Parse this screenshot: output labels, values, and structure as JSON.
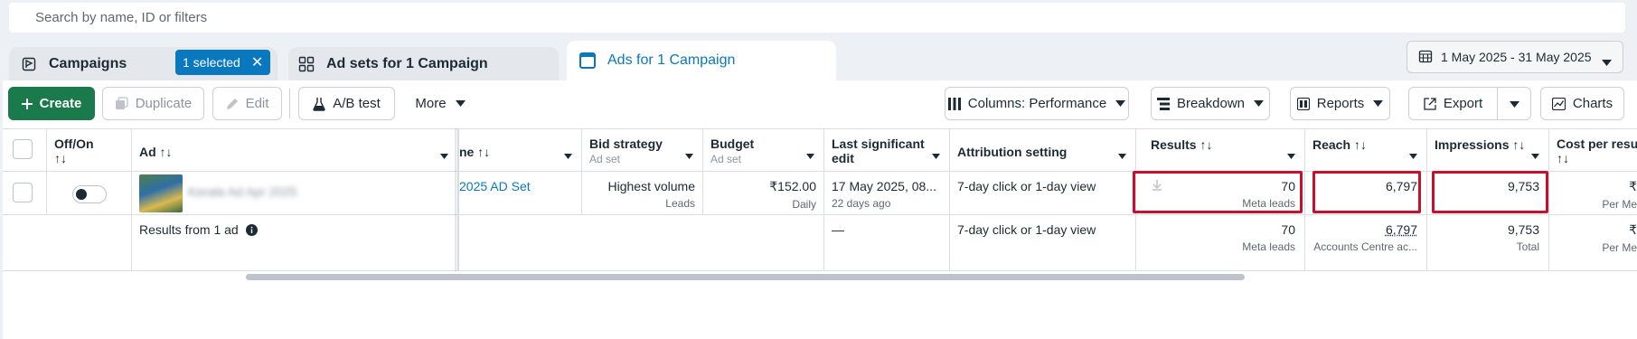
{
  "search": {
    "placeholder": "Search by name, ID or filters"
  },
  "tabs": {
    "campaigns": {
      "label": "Campaigns",
      "selected_badge": "1 selected"
    },
    "adsets": {
      "label": "Ad sets for 1 Campaign"
    },
    "ads": {
      "label": "Ads for 1 Campaign"
    }
  },
  "date_range": "1 May 2025 - 31 May 2025",
  "toolbar": {
    "create": "Create",
    "duplicate": "Duplicate",
    "edit": "Edit",
    "ab_test": "A/B test",
    "more": "More",
    "columns": "Columns: Performance",
    "breakdown": "Breakdown",
    "reports": "Reports",
    "export": "Export",
    "charts": "Charts"
  },
  "table": {
    "headers": {
      "off_on": "Off/On",
      "off_on_sort": "↑↓",
      "ad": "Ad ↑↓",
      "name_partial": "ne ↑↓",
      "bid_strategy": "Bid strategy",
      "bid_strategy_sub": "Ad set",
      "budget": "Budget",
      "budget_sub": "Ad set",
      "last_edit_1": "Last significant",
      "last_edit_2": "edit",
      "attribution": "Attribution setting",
      "results": "Results ↑↓",
      "reach": "Reach ↑↓",
      "impressions": "Impressions ↑↓",
      "cost_per_result_1": "Cost per resu",
      "cost_per_result_2": "↑↓"
    },
    "row": {
      "ad_name": "Kerala Ad Apr 2025",
      "adset_partial": "2025 AD Set",
      "bid_strategy": "Highest volume",
      "bid_strategy_sub": "Leads",
      "budget": "₹152.00",
      "budget_sub": "Daily",
      "last_edit": "17 May 2025, 08...",
      "last_edit_sub": "22 days ago",
      "attribution": "7-day click or 1-day view",
      "results": "70",
      "results_sub": "Meta leads",
      "reach": "6,797",
      "impressions": "9,753",
      "cost": "₹",
      "cost_sub": "Per Me"
    },
    "summary": {
      "label": "Results from 1 ad",
      "last_edit": "—",
      "attribution": "7-day click or 1-day view",
      "results": "70",
      "results_sub": "Meta leads",
      "reach": "6,797",
      "reach_sub": "Accounts Centre ac...",
      "impressions": "9,753",
      "impressions_sub": "Total",
      "cost": "₹",
      "cost_sub": "Per Me"
    }
  },
  "colors": {
    "accent": "#0a78be",
    "create": "#1a7a4c",
    "highlight": "#c8102e"
  }
}
